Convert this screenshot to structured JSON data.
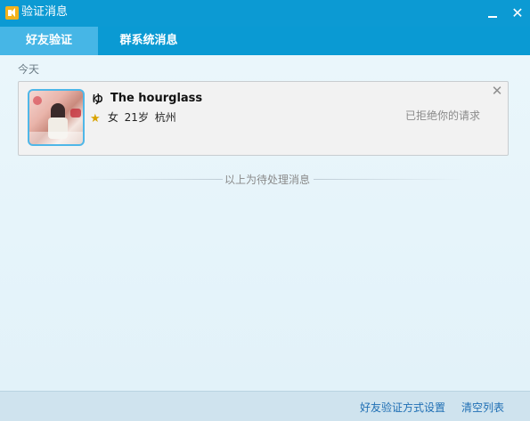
{
  "window": {
    "title": "验证消息"
  },
  "tabs": [
    {
      "label": "好友验证",
      "active": true
    },
    {
      "label": "群系统消息",
      "active": false
    }
  ],
  "content": {
    "section_label": "今天",
    "message": {
      "nick_icon": "ゆ",
      "nickname": "The hourglass",
      "gender": "女",
      "age": "21岁",
      "city": "杭州",
      "status": "已拒绝你的请求"
    },
    "divider_text": "以上为待处理消息"
  },
  "footer": {
    "settings_link": "好友验证方式设置",
    "clear_link": "清空列表"
  },
  "colors": {
    "titlebar": "#0c9ad3",
    "active_tab": "#46b6e6",
    "link": "#1f6fb4"
  }
}
